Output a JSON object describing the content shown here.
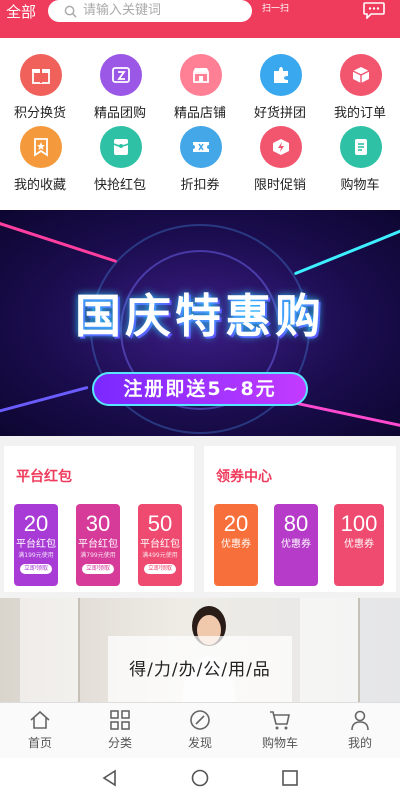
{
  "header": {
    "category_label": "全部",
    "search_placeholder": "请输入关键词",
    "scan_label": "扫一扫",
    "bg_color": "#ef3b5c",
    "search_icon": "search-icon",
    "message_icon": "chat-bubble-icon"
  },
  "menu": {
    "items": [
      {
        "label": "积分换货",
        "icon": "gift-icon",
        "color": "#f0615c"
      },
      {
        "label": "精品团购",
        "icon": "group-buy-icon",
        "color": "#9b57e6"
      },
      {
        "label": "精品店铺",
        "icon": "store-icon",
        "color": "#ff7f94"
      },
      {
        "label": "好货拼团",
        "icon": "puzzle-icon",
        "color": "#3aa8ef"
      },
      {
        "label": "我的订单",
        "icon": "order-box-icon",
        "color": "#f2566f"
      },
      {
        "label": "我的收藏",
        "icon": "bookmark-icon",
        "color": "#f59a3c"
      },
      {
        "label": "快抢红包",
        "icon": "red-packet-icon",
        "color": "#2fc1a6"
      },
      {
        "label": "折扣券",
        "icon": "discount-coupon-icon",
        "color": "#43a7e8"
      },
      {
        "label": "限时促销",
        "icon": "flash-sale-icon",
        "color": "#f2566f"
      },
      {
        "label": "购物车",
        "icon": "cart-icon",
        "color": "#2fc1a6"
      }
    ]
  },
  "banner": {
    "title": "国庆特惠购",
    "subtitle": "注册即送5~8元"
  },
  "coupons": {
    "platform": {
      "title": "平台红包",
      "tickets": [
        {
          "amount": "20",
          "label": "平台红包",
          "condition": "满199元使用",
          "button": "立即领取",
          "color": "#a83bd6"
        },
        {
          "amount": "30",
          "label": "平台红包",
          "condition": "满799元使用",
          "button": "立即领取",
          "color": "#d63b9a"
        },
        {
          "amount": "50",
          "label": "平台红包",
          "condition": "满499元使用",
          "button": "立即领取",
          "color": "#ef4a6f"
        }
      ]
    },
    "center": {
      "title": "领券中心",
      "tickets": [
        {
          "amount": "20",
          "label": "优惠券",
          "condition": "",
          "color": "#f76f3a"
        },
        {
          "amount": "80",
          "label": "优惠券",
          "condition": "",
          "color": "#b63bc9"
        },
        {
          "amount": "100",
          "label": "优惠券",
          "condition": "",
          "color": "#ef4a6f"
        }
      ]
    }
  },
  "product": {
    "caption": "得/力/办/公/用/品"
  },
  "tabbar": {
    "items": [
      {
        "label": "首页",
        "icon": "home-icon"
      },
      {
        "label": "分类",
        "icon": "grid-icon"
      },
      {
        "label": "发现",
        "icon": "compass-icon"
      },
      {
        "label": "购物车",
        "icon": "cart-icon"
      },
      {
        "label": "我的",
        "icon": "user-icon"
      }
    ]
  },
  "system_nav": {
    "items": [
      {
        "icon": "back-triangle-icon"
      },
      {
        "icon": "home-circle-icon"
      },
      {
        "icon": "recents-square-icon"
      }
    ]
  }
}
